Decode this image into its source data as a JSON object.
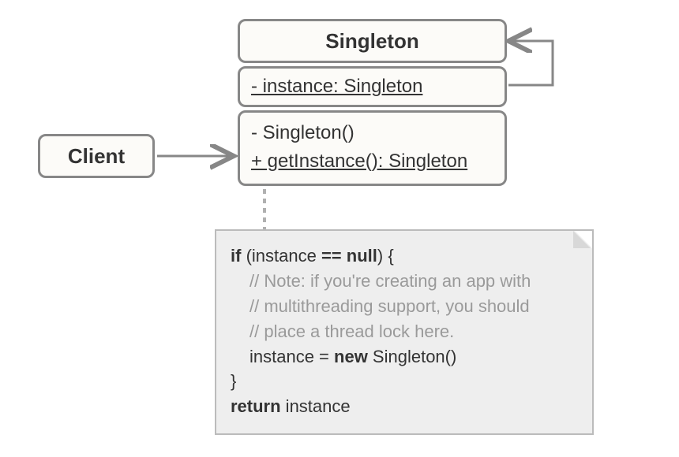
{
  "diagram": {
    "client": {
      "label": "Client"
    },
    "singleton": {
      "name": "Singleton",
      "attribute": "- instance: Singleton",
      "method1": "- Singleton()",
      "method2": "+ getInstance(): Singleton"
    },
    "note": {
      "line1_kw1": "if",
      "line1_mid": " (instance ",
      "line1_kw2": "==",
      "line1_mid2": " ",
      "line1_kw3": "null",
      "line1_end": ") {",
      "comment1": "// Note: if you're creating an app with",
      "comment2": "// multithreading support, you should",
      "comment3": "// place a thread lock here.",
      "line5_a": "instance = ",
      "line5_kw": "new",
      "line5_b": " Singleton()",
      "line6": "}",
      "line7_kw": "return",
      "line7_b": " instance"
    }
  }
}
